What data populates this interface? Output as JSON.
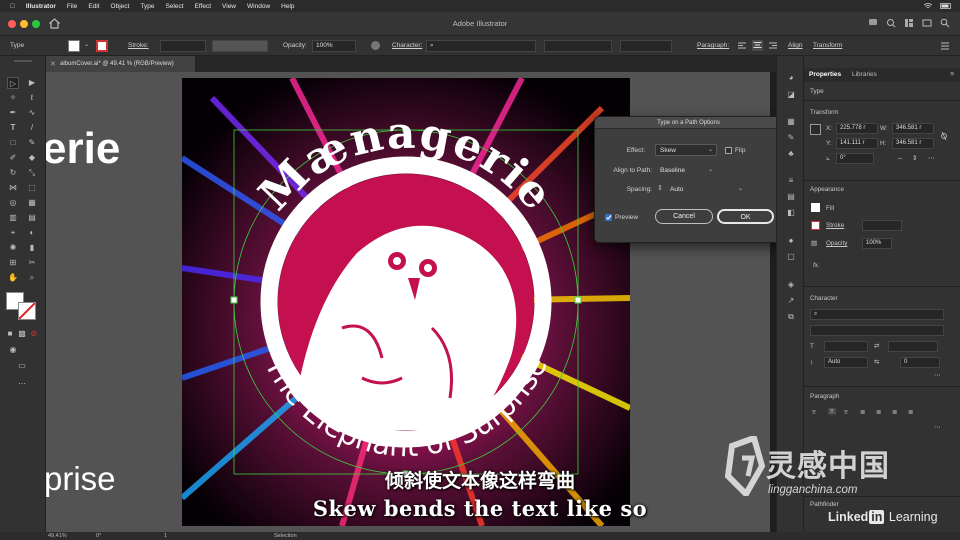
{
  "menubar": {
    "apple": "",
    "app": "Illustrator",
    "items": [
      "File",
      "Edit",
      "Object",
      "Type",
      "Select",
      "Effect",
      "View",
      "Window",
      "Help"
    ]
  },
  "appbar": {
    "title": "Adobe Illustrator"
  },
  "controlbar": {
    "selection_type": "Type",
    "stroke_label": "Stroke:",
    "opacity_label": "Opacity:",
    "opacity_value": "100%",
    "character_label": "Character:",
    "paragraph_label": "Paragraph:",
    "align_label": "Align",
    "transform_label": "Transform"
  },
  "document": {
    "tab_title": "albumCover.ai* @ 49.41 % (RGB/Preview)"
  },
  "canvas": {
    "cut_text_top": "erie",
    "cut_text_bottom": "prise",
    "arc_title": "Mænagerie",
    "arc_subtitle": "The Elephant of Surprise"
  },
  "dialog": {
    "title": "Type on a Path Options",
    "effect_label": "Effect:",
    "effect_value": "Skew",
    "flip_label": "Flip",
    "align_label": "Align to Path:",
    "align_value": "Baseline",
    "spacing_label": "Spacing:",
    "spacing_value": "Auto",
    "preview_label": "Preview",
    "cancel_label": "Cancel",
    "ok_label": "OK"
  },
  "properties": {
    "tab_properties": "Properties",
    "tab_libraries": "Libraries",
    "type_section": "Type",
    "transform_section": "Transform",
    "x_label": "X:",
    "x_value": "225.778 r",
    "y_label": "Y:",
    "y_value": "141.111 r",
    "w_label": "W:",
    "w_value": "346.581 r",
    "h_label": "H:",
    "h_value": "346.581 r",
    "rotate_value": "0°",
    "appearance_section": "Appearance",
    "fill_label": "Fill",
    "stroke_label": "Stroke",
    "opacity_label": "Opacity",
    "opacity_value": "100%",
    "fx_label": "fx.",
    "character_section": "Character",
    "leading_value": "Auto",
    "tracking_value": "0",
    "paragraph_section": "Paragraph",
    "pathfinder_section": "Pathfinder"
  },
  "statusbar": {
    "zoom": "49.41%",
    "rotation": "0°",
    "artboard": "1",
    "mode": "Selection"
  },
  "subtitles": {
    "cn": "倾斜使文本像这样弯曲",
    "en": "Skew bends the text like so"
  },
  "watermark": {
    "brand": "灵感中国",
    "url": "lingganchina.com",
    "linkedin_word": "Linked",
    "linkedin_box": "in",
    "learning": "Learning"
  },
  "colors": {
    "accent": "#2f6fd6",
    "traffic_red": "#ff5f57",
    "traffic_yellow": "#febc2e",
    "traffic_green": "#28c840"
  }
}
